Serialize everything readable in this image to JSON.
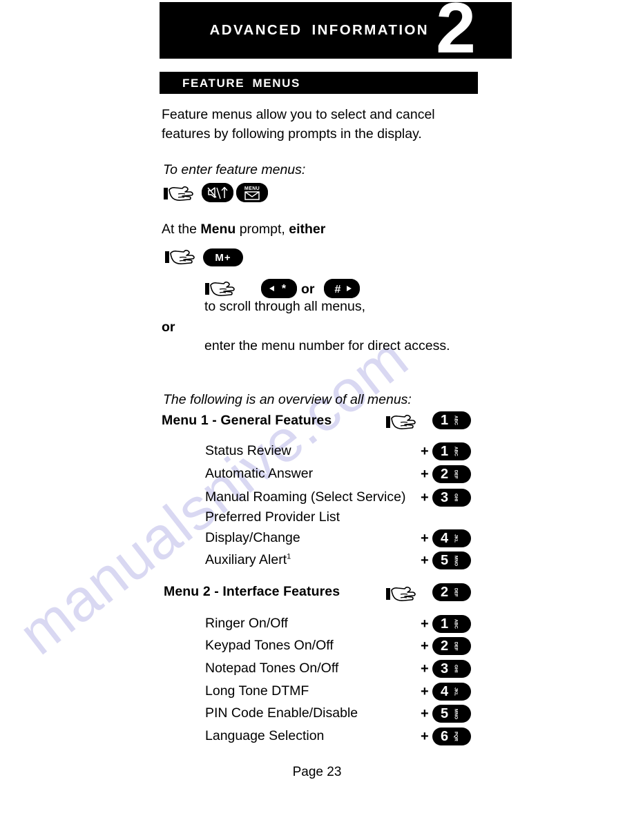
{
  "chapter": {
    "title": "ADVANCED INFORMATION",
    "number": "2"
  },
  "section": {
    "title": "FEATURE MENUS"
  },
  "intro": "Feature menus allow you to select and cancel features by following prompts in the display.",
  "enter_menus": {
    "lead": "To enter feature menus:",
    "hand_icon": "pointing-hand-icon",
    "keys": [
      {
        "icon": "mute-volume-up-key",
        "label": ""
      },
      {
        "icon": "menu-envelope-key",
        "label": "MENU"
      }
    ]
  },
  "menu_prompt": {
    "text_before": "At the ",
    "bold_1": "Menu",
    "text_middle": " prompt, ",
    "bold_2": "either"
  },
  "m_plus": {
    "hand_icon": "pointing-hand-icon",
    "key_label": "M+"
  },
  "scroll": {
    "hand_icon": "pointing-hand-icon",
    "key_star": "*",
    "or_label": "or",
    "key_pound": "#",
    "caption": "to scroll through all menus,"
  },
  "alternative": {
    "or_label": "or",
    "text": "enter the menu number for direct access."
  },
  "overview_lead": "The following is an overview of all menus:",
  "menus": [
    {
      "heading": "Menu 1 - General Features",
      "hand_icon": "pointing-hand-icon",
      "key": {
        "digit": "1",
        "letters": "ABC"
      },
      "items": [
        {
          "label": "Status Review",
          "plus": "+",
          "key": {
            "digit": "1",
            "letters": "ABC"
          }
        },
        {
          "label": "Automatic Answer",
          "plus": "+",
          "key": {
            "digit": "2",
            "letters": "DEF"
          }
        },
        {
          "label": "Manual Roaming (Select Service)",
          "plus": "+",
          "key": {
            "digit": "3",
            "letters": "GHI"
          }
        },
        {
          "label": "Preferred  Provider  List",
          "plus": "",
          "key": null
        },
        {
          "label": "Display/Change",
          "plus": "+",
          "key": {
            "digit": "4",
            "letters": "JKL"
          }
        },
        {
          "label": "Auxiliary Alert",
          "footnote": "1",
          "plus": "+",
          "key": {
            "digit": "5",
            "letters": "MNO"
          }
        }
      ]
    },
    {
      "heading": "Menu 2 - Interface Features",
      "hand_icon": "pointing-hand-icon",
      "key": {
        "digit": "2",
        "letters": "DEF"
      },
      "items": [
        {
          "label": "Ringer On/Off",
          "plus": "+",
          "key": {
            "digit": "1",
            "letters": "ABC"
          }
        },
        {
          "label": "Keypad Tones On/Off",
          "plus": "+",
          "key": {
            "digit": "2",
            "letters": "DEF"
          }
        },
        {
          "label": "Notepad Tones On/Off",
          "plus": "+",
          "key": {
            "digit": "3",
            "letters": "GHI"
          }
        },
        {
          "label": "Long Tone DTMF",
          "plus": "+",
          "key": {
            "digit": "4",
            "letters": "JKL"
          }
        },
        {
          "label": "PIN Code Enable/Disable",
          "plus": "+",
          "key": {
            "digit": "5",
            "letters": "MNO"
          }
        },
        {
          "label": "Language Selection",
          "plus": "+",
          "key": {
            "digit": "6",
            "letters": "PQR"
          }
        }
      ]
    }
  ],
  "footer": "Page 23",
  "watermark": "manualsnive.com",
  "colors": {
    "ink": "#000000",
    "paper": "#ffffff",
    "watermark": "#d9d8f2"
  }
}
